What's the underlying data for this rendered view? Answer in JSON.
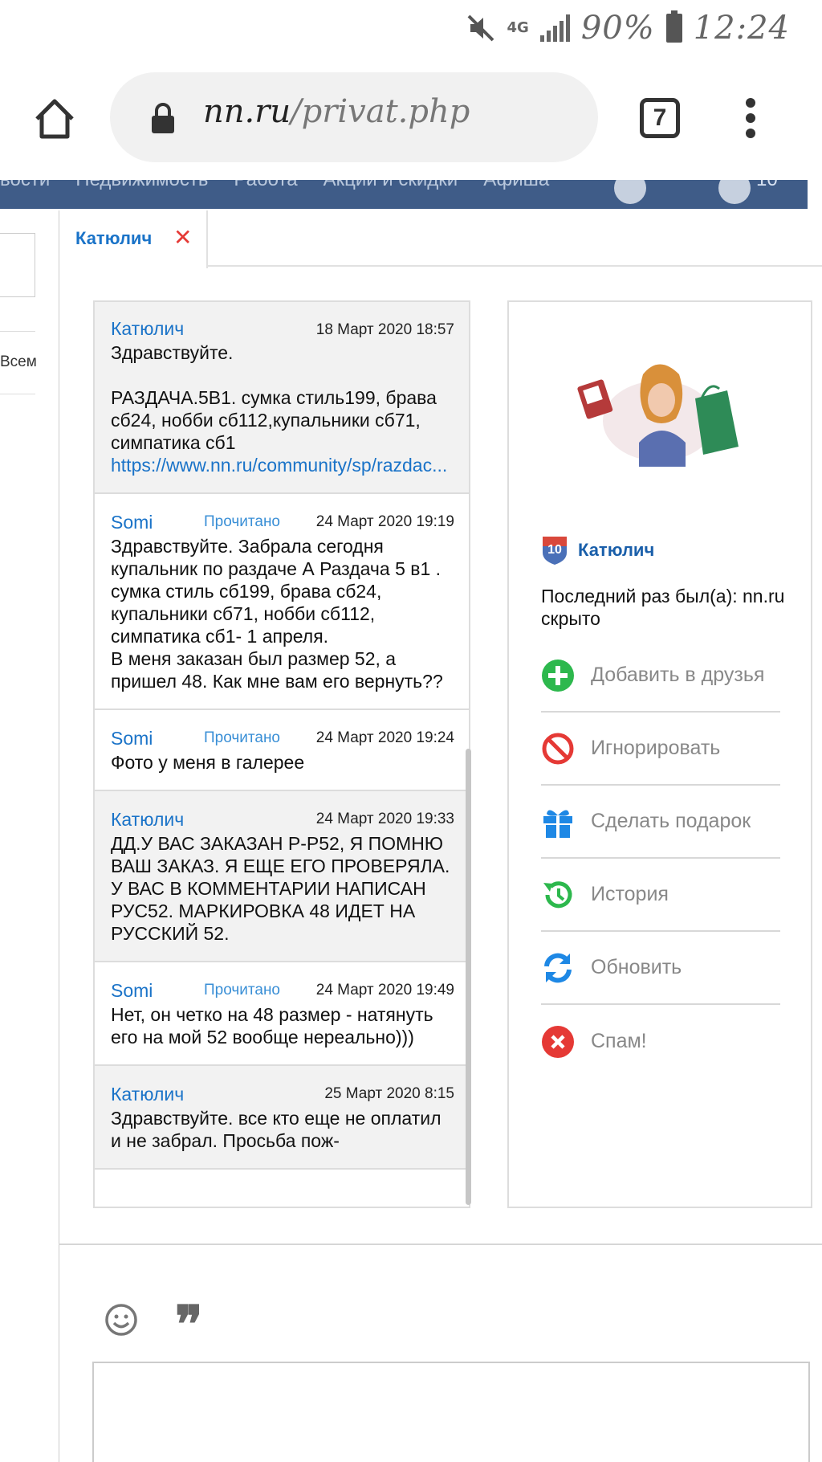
{
  "status_bar": {
    "network": "4G",
    "battery": "90%",
    "time": "12:24"
  },
  "browser": {
    "url_host": "nn.ru",
    "url_path": "/privat.php",
    "tab_count": "7"
  },
  "site_nav": {
    "items": [
      "вости",
      "Недвижимость",
      "Работа",
      "Акции и скидки",
      "Афиша"
    ],
    "badge": "10"
  },
  "left_sliver": {
    "text": "Всем"
  },
  "conversation_tab": {
    "label": "Катюлич",
    "close_glyph": "✕"
  },
  "messages": [
    {
      "author": "Катюлич",
      "status": "",
      "date": "18 Март 2020 18:57",
      "text": "Здравствуйте.\n\nРАЗДАЧА.5В1. сумка стиль199, брава сб24, нобби сб112,купальники сб71, симпатика сб1",
      "link": "https://www.nn.ru/community/sp/razdac...",
      "own": true
    },
    {
      "author": "Somi",
      "status": "Прочитано",
      "date": "24 Март 2020 19:19",
      "text": "Здравствуйте. Забрала сегодня купальник по раздаче А Раздача 5 в1 . сумка стиль сб199, брава сб24, купальники сб71, нобби сб112, симпатика сб1- 1 апреля.\nВ меня заказан был размер 52, а пришел 48. Как мне вам его вернуть??",
      "link": "",
      "own": false
    },
    {
      "author": "Somi",
      "status": "Прочитано",
      "date": "24 Март 2020 19:24",
      "text": "Фото у меня в галерее",
      "link": "",
      "own": false
    },
    {
      "author": "Катюлич",
      "status": "",
      "date": "24 Март 2020 19:33",
      "text": "ДД.У ВАС ЗАКАЗАН Р-Р52, Я ПОМНЮ ВАШ ЗАКАЗ. Я ЕЩЕ ЕГО ПРОВЕРЯЛА. У ВАС В КОММЕНТАРИИ НАПИСАН РУС52. МАРКИРОВКА 48 ИДЕТ НА РУССКИЙ 52.",
      "link": "",
      "own": true
    },
    {
      "author": "Somi",
      "status": "Прочитано",
      "date": "24 Март 2020 19:49",
      "text": "Нет, он четко на 48 размер - натянуть его на мой 52 вообще нереально)))",
      "link": "",
      "own": false
    },
    {
      "author": "Катюлич",
      "status": "",
      "date": "25 Март 2020 8:15",
      "text": "Здравствуйте. все кто еще не оплатил и не забрал. Просьба пож-",
      "link": "",
      "own": true
    }
  ],
  "profile": {
    "level": "10",
    "name": "Катюлич",
    "last_seen": "Последний раз был(а): nn.ru скрыто",
    "actions": [
      {
        "label": "Добавить в друзья",
        "icon": "add-friend-icon",
        "color": "#2db84d"
      },
      {
        "label": "Игнорировать",
        "icon": "ignore-icon",
        "color": "#e53935"
      },
      {
        "label": "Сделать подарок",
        "icon": "gift-icon",
        "color": "#1e88e5"
      },
      {
        "label": "История",
        "icon": "history-icon",
        "color": "#2db84d"
      },
      {
        "label": "Обновить",
        "icon": "refresh-icon",
        "color": "#1e88e5"
      },
      {
        "label": "Спам!",
        "icon": "spam-icon",
        "color": "#e53935"
      }
    ]
  },
  "composer": {
    "emoji_icon": "emoji-icon",
    "quote_glyph": "❞"
  },
  "colors": {
    "link_blue": "#1a73c8",
    "nav_bg": "#3f5c88",
    "own_msg_bg": "#f2f2f2"
  }
}
